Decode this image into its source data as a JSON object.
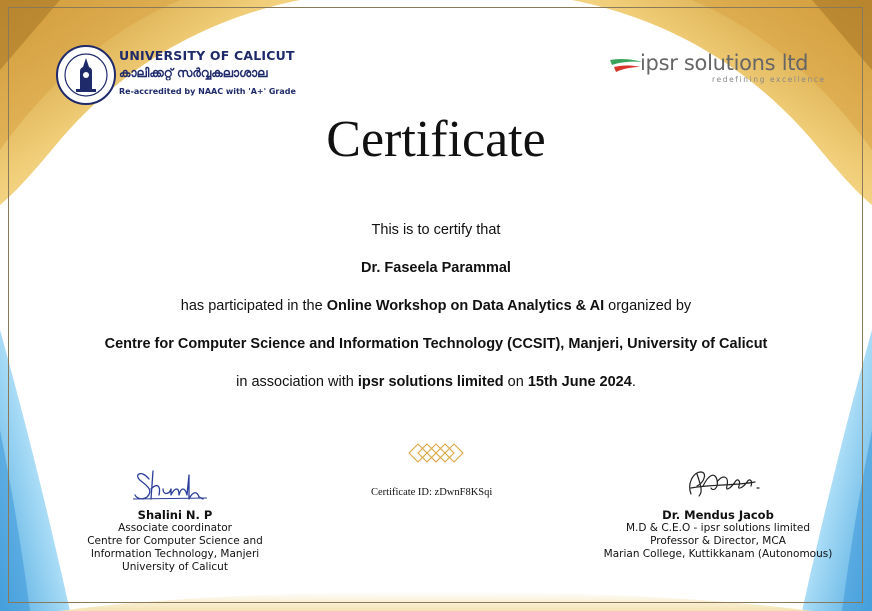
{
  "header": {
    "university_name": "UNIVERSITY OF CALICUT",
    "university_name_malayalam": "കാലിക്കറ്റ് സർവ്വകലാശാല",
    "accreditation": "Re-accredited by NAAC with 'A+' Grade",
    "logo_lettering": "UNIVERSITY OF CALICUT",
    "partner_name": "ipsr solutions ltd",
    "partner_tagline": "redefining excellence"
  },
  "title": "Certificate",
  "body": {
    "line1": "This is to certify that",
    "recipient": "Dr. Faseela Parammal",
    "line3_pre": "has participated in the ",
    "workshop": "Online Workshop on Data Analytics & AI",
    "line3_post": " organized by",
    "organizer": "Centre for Computer Science and Information Technology (CCSIT), Manjeri, University of Calicut",
    "line5_pre": "in association with ",
    "partner": "ipsr solutions limited",
    "line5_mid": " on ",
    "date": "15th June 2024",
    "line5_post": "."
  },
  "certificate_id": "Certificate ID: zDwnF8KSqi",
  "signatory_left": {
    "name": "Shalini N. P",
    "role": "Associate coordinator",
    "org_line1": "Centre for Computer Science and",
    "org_line2": "Information Technology, Manjeri",
    "org_line3": "University of Calicut"
  },
  "signatory_right": {
    "name": "Dr. Mendus Jacob",
    "role": "M.D & C.E.O - ipsr solutions limited",
    "title_line": "Professor & Director, MCA",
    "org_line": "Marian College, Kuttikkanam (Autonomous)"
  },
  "colors": {
    "gold": "#d9a640",
    "light_gold": "#f3dca0",
    "sky_blue": "#7cc4ee",
    "navy": "#1f2a6b",
    "ipsr_green": "#3aa35b",
    "ipsr_red": "#d9362b"
  }
}
